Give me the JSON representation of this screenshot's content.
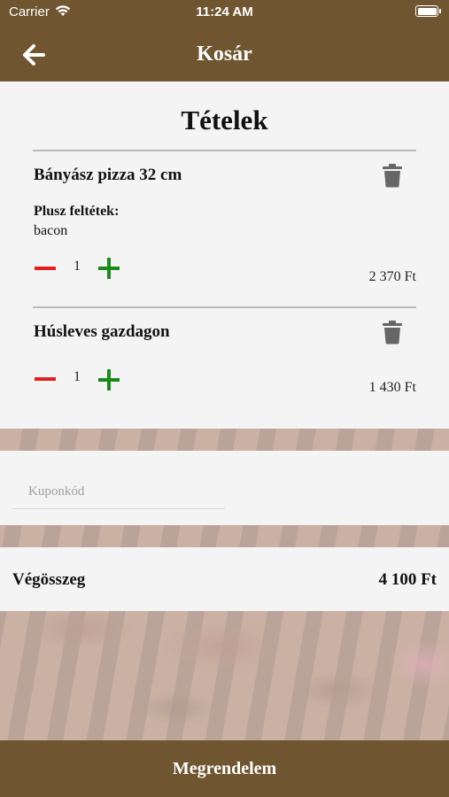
{
  "status_bar": {
    "carrier": "Carrier",
    "time": "11:24 AM"
  },
  "nav": {
    "title": "Kosár",
    "back_icon": "arrow-left-icon"
  },
  "cart": {
    "title": "Tételek",
    "items": [
      {
        "name": "Bányász pizza 32 cm",
        "extras_label": "Plusz feltétek:",
        "extras": "bacon",
        "quantity": "1",
        "price": "2 370 Ft"
      },
      {
        "name": "Húsleves gazdagon",
        "quantity": "1",
        "price": "1 430 Ft"
      }
    ]
  },
  "coupon": {
    "placeholder": "Kuponkód",
    "value": ""
  },
  "total": {
    "label": "Végösszeg",
    "value": "4 100 Ft"
  },
  "order_button": {
    "label": "Megrendelem"
  },
  "colors": {
    "brand": "#6f5631",
    "minus": "#e02020",
    "plus": "#1a8a1a",
    "card": "#f4f4f4"
  }
}
